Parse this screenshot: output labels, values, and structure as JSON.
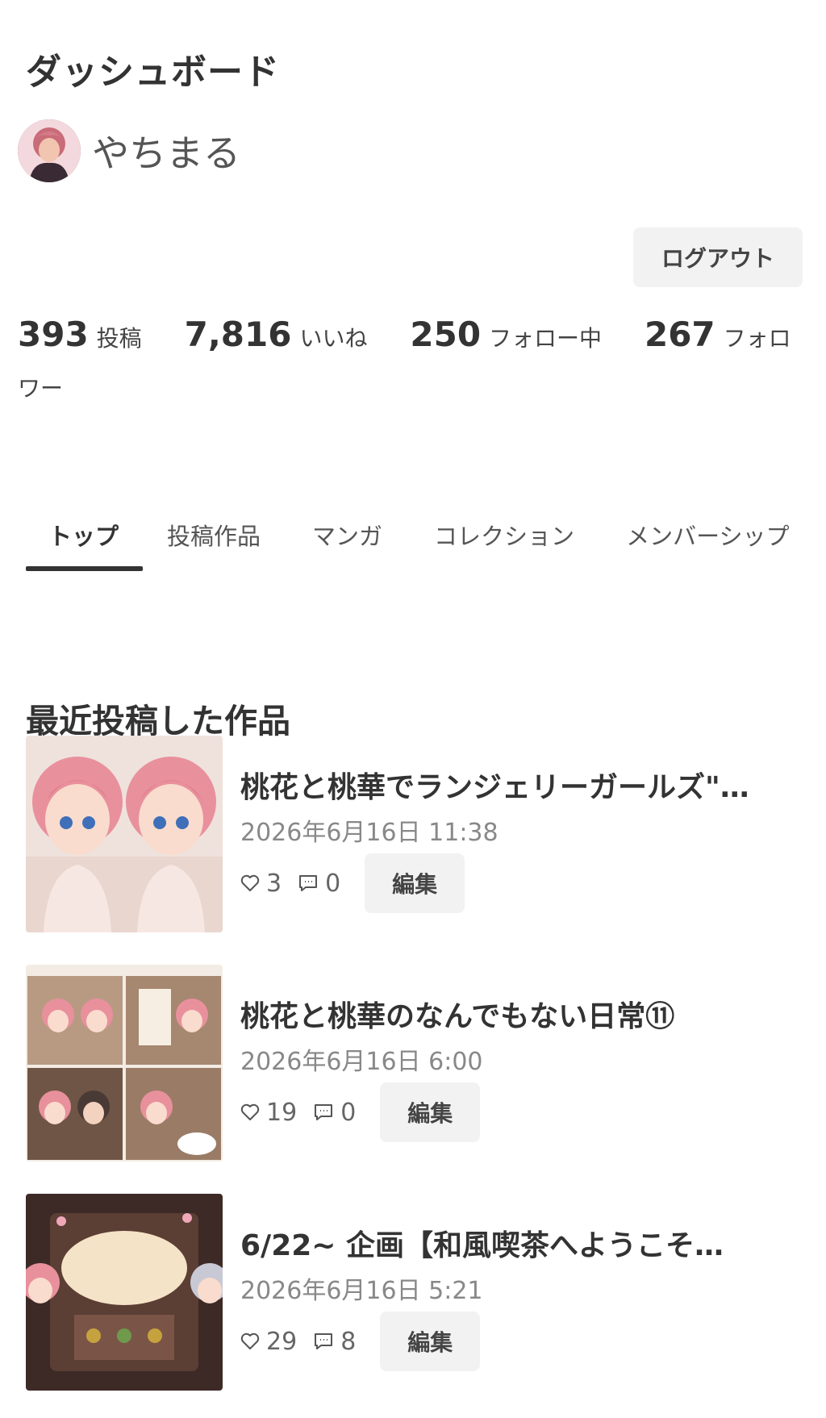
{
  "header": {
    "title": "ダッシュボード"
  },
  "profile": {
    "name": "やちまる"
  },
  "actions": {
    "logout_label": "ログアウト"
  },
  "stats": [
    {
      "value": "393",
      "label": "投稿"
    },
    {
      "value": "7,816",
      "label": "いいね"
    },
    {
      "value": "250",
      "label": "フォロー中"
    },
    {
      "value": "267",
      "label": "フォロワー"
    }
  ],
  "tabs": [
    {
      "label": "トップ",
      "active": true
    },
    {
      "label": "投稿作品",
      "active": false
    },
    {
      "label": "マンガ",
      "active": false
    },
    {
      "label": "コレクション",
      "active": false
    },
    {
      "label": "メンバーシップ",
      "active": false
    }
  ],
  "recent": {
    "title": "最近投稿した作品",
    "edit_label": "編集",
    "posts": [
      {
        "title": "桃花と桃華でランジェリーガールズ\"…",
        "date": "2026年6月16日 11:38",
        "likes": "3",
        "comments": "0"
      },
      {
        "title": "桃花と桃華のなんでもない日常⑪",
        "date": "2026年6月16日 6:00",
        "likes": "19",
        "comments": "0"
      },
      {
        "title": "6/22~ 企画【和風喫茶へようこそ…",
        "date": "2026年6月16日 5:21",
        "likes": "29",
        "comments": "8"
      }
    ]
  },
  "colors": {
    "text": "#333333",
    "muted": "#888888",
    "button_bg": "#f2f2f2",
    "tab_indicator": "#333333"
  },
  "icons": {
    "like": "heart-icon",
    "comment": "comment-icon"
  }
}
